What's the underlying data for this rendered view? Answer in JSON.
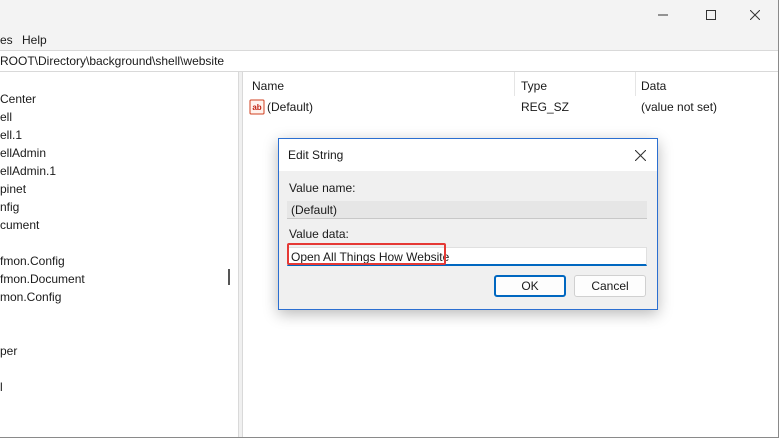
{
  "menu": {
    "items": [
      "es",
      "Help"
    ]
  },
  "address": {
    "path": "ROOT\\Directory\\background\\shell\\website"
  },
  "tree": {
    "items": [
      "Center",
      "ell",
      "ell.1",
      "ellAdmin",
      "ellAdmin.1",
      "pinet",
      "nfig",
      "cument",
      "fmon.Config",
      "fmon.Document",
      "mon.Config",
      "",
      "",
      "",
      "per",
      "",
      "l"
    ]
  },
  "list": {
    "columns": [
      "Name",
      "Type",
      "Data"
    ],
    "rows": [
      {
        "icon": "string-value-icon",
        "name": "(Default)",
        "type": "REG_SZ",
        "data": "(value not set)"
      }
    ]
  },
  "dialog": {
    "title": "Edit String",
    "value_name_label": "Value name:",
    "value_name": "(Default)",
    "value_data_label": "Value data:",
    "value_data": "Open All Things How Website",
    "ok_label": "OK",
    "cancel_label": "Cancel"
  },
  "colors": {
    "accent": "#0067c0",
    "dialog_border": "#2b6fd1",
    "highlight": "#e53935",
    "chrome": "#f3f3f3"
  }
}
